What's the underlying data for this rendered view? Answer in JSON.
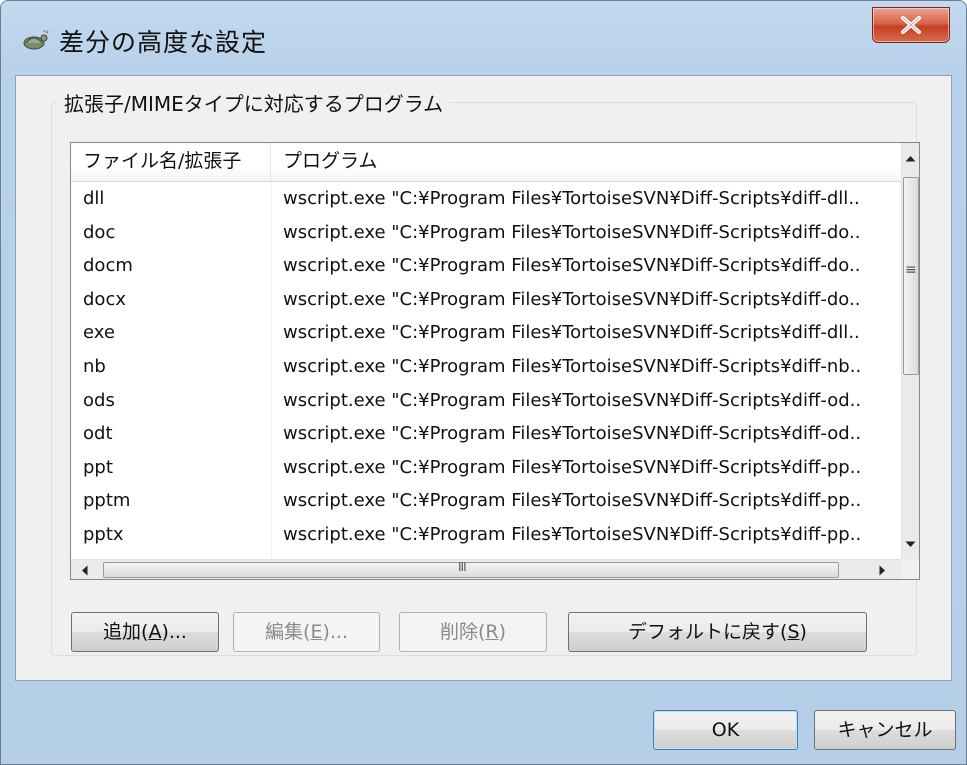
{
  "window": {
    "title": "差分の高度な設定",
    "icon": "tortoise-app-icon",
    "close_icon": "close-icon"
  },
  "group": {
    "title": "拡張子/MIMEタイプに対応するプログラム"
  },
  "table": {
    "columns": [
      "ファイル名/拡張子",
      "プログラム"
    ],
    "rows": [
      {
        "ext": "dll",
        "program": "wscript.exe \"C:¥Program Files¥TortoiseSVN¥Diff-Scripts¥diff-dll.."
      },
      {
        "ext": "doc",
        "program": "wscript.exe \"C:¥Program Files¥TortoiseSVN¥Diff-Scripts¥diff-do.."
      },
      {
        "ext": "docm",
        "program": "wscript.exe \"C:¥Program Files¥TortoiseSVN¥Diff-Scripts¥diff-do.."
      },
      {
        "ext": "docx",
        "program": "wscript.exe \"C:¥Program Files¥TortoiseSVN¥Diff-Scripts¥diff-do.."
      },
      {
        "ext": "exe",
        "program": "wscript.exe \"C:¥Program Files¥TortoiseSVN¥Diff-Scripts¥diff-dll.."
      },
      {
        "ext": "nb",
        "program": "wscript.exe \"C:¥Program Files¥TortoiseSVN¥Diff-Scripts¥diff-nb.."
      },
      {
        "ext": "ods",
        "program": "wscript.exe \"C:¥Program Files¥TortoiseSVN¥Diff-Scripts¥diff-od.."
      },
      {
        "ext": "odt",
        "program": "wscript.exe \"C:¥Program Files¥TortoiseSVN¥Diff-Scripts¥diff-od.."
      },
      {
        "ext": "ppt",
        "program": "wscript.exe \"C:¥Program Files¥TortoiseSVN¥Diff-Scripts¥diff-pp.."
      },
      {
        "ext": "pptm",
        "program": "wscript.exe \"C:¥Program Files¥TortoiseSVN¥Diff-Scripts¥diff-pp.."
      },
      {
        "ext": "pptx",
        "program": "wscript.exe \"C:¥Program Files¥TortoiseSVN¥Diff-Scripts¥diff-pp.."
      }
    ]
  },
  "scrollbars": {
    "up_icon": "scroll-up-arrow-icon",
    "down_icon": "scroll-down-arrow-icon",
    "left_icon": "scroll-left-arrow-icon",
    "right_icon": "scroll-right-arrow-icon",
    "grip_v": "≡",
    "grip_h": "III"
  },
  "buttons": {
    "add": {
      "label": "追加(",
      "mnemonic": "A",
      "suffix": ")..."
    },
    "edit": {
      "label": "編集(",
      "mnemonic": "E",
      "suffix": ")..."
    },
    "delete": {
      "label": "削除(",
      "mnemonic": "R",
      "suffix": ")"
    },
    "restore_default": {
      "label": "デフォルトに戻す(",
      "mnemonic": "S",
      "suffix": ")"
    },
    "ok": "OK",
    "cancel": "キャンセル"
  }
}
